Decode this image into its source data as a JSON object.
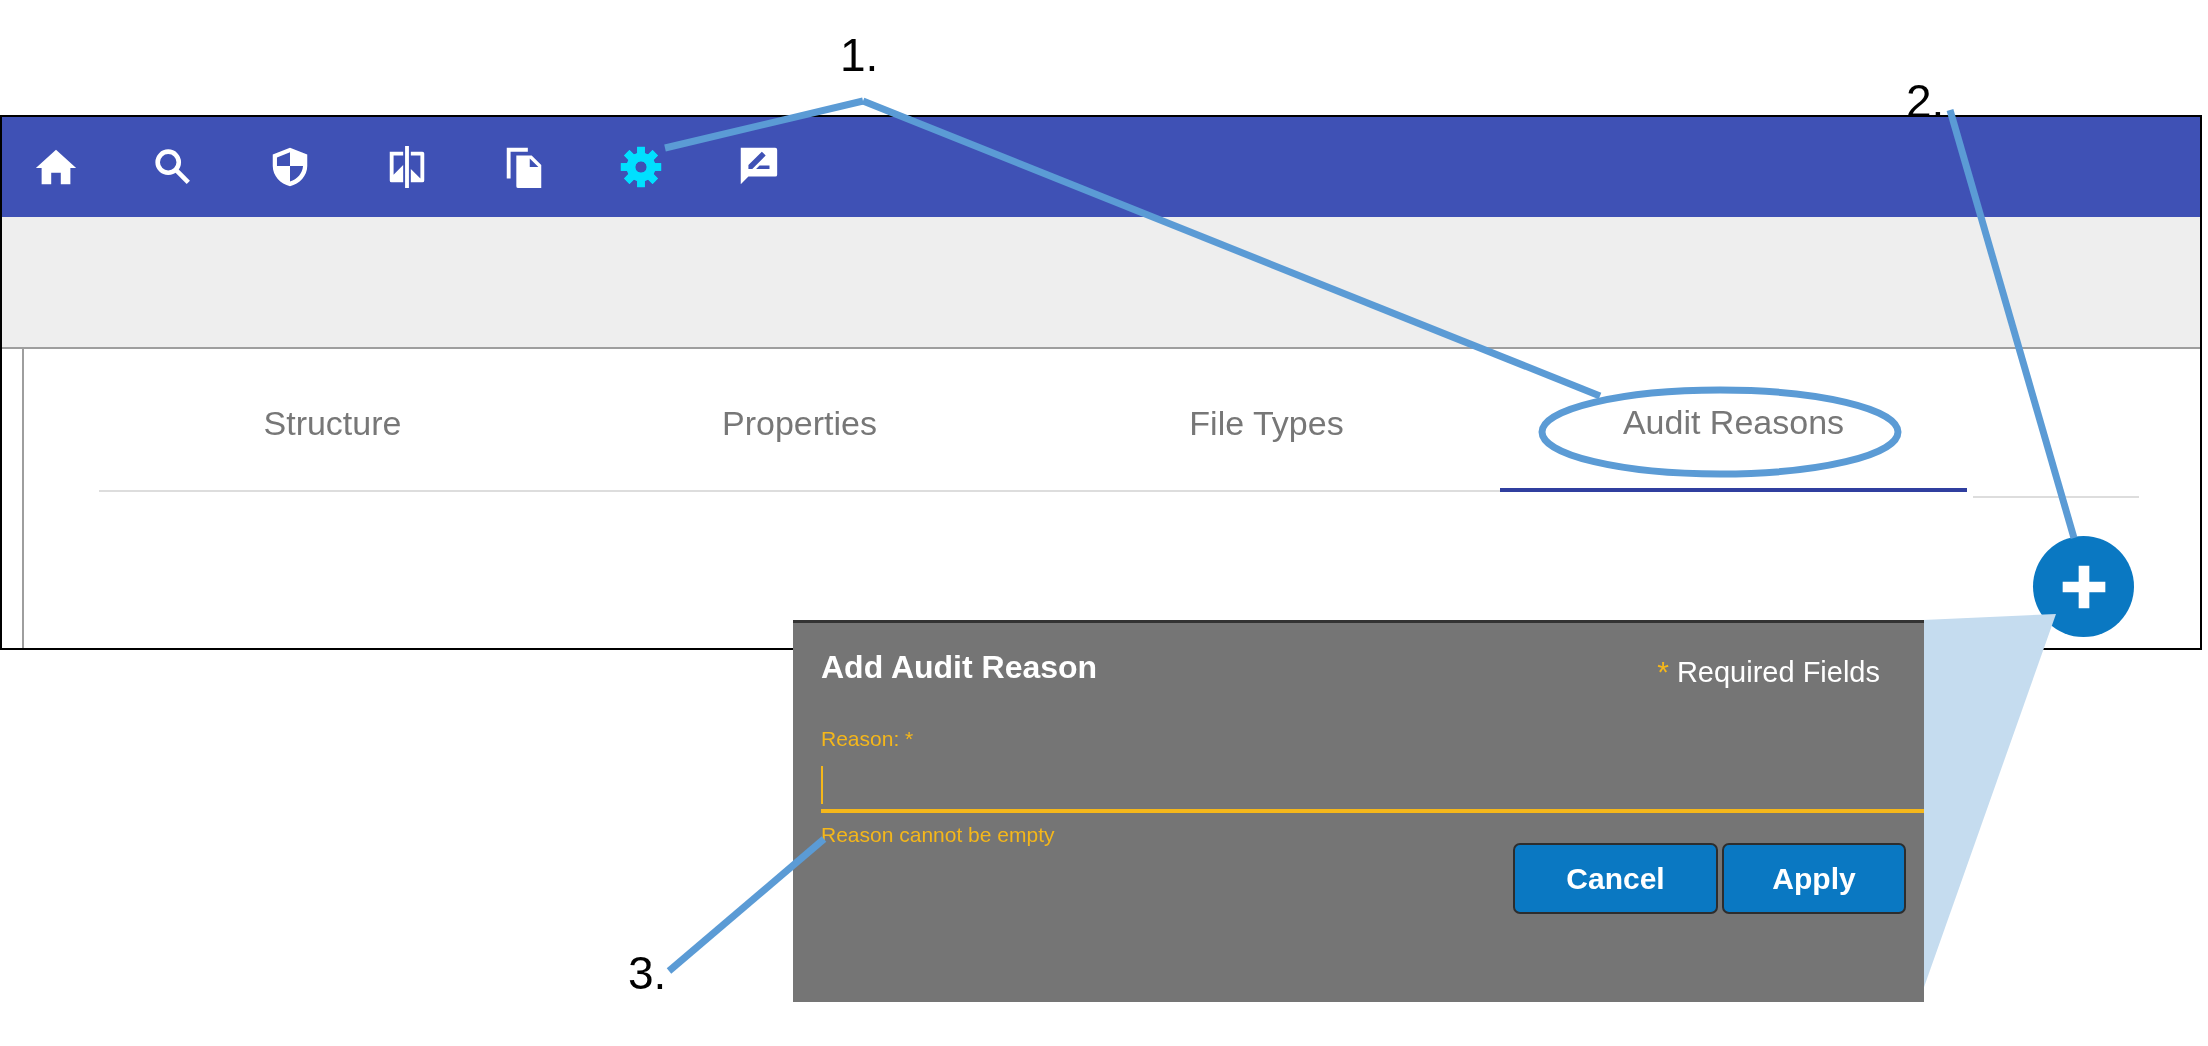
{
  "toolbar": [
    {
      "kind": "home",
      "selected": false
    },
    {
      "kind": "search",
      "selected": false
    },
    {
      "kind": "shield",
      "selected": false
    },
    {
      "kind": "compare",
      "selected": false
    },
    {
      "kind": "copy",
      "selected": false
    },
    {
      "kind": "settings",
      "selected": true
    },
    {
      "kind": "feedback",
      "selected": false
    }
  ],
  "tabs": [
    {
      "label": "Structure",
      "selected": false
    },
    {
      "label": "Properties",
      "selected": false
    },
    {
      "label": "File Types",
      "selected": false
    },
    {
      "label": "Audit Reasons",
      "selected": true
    }
  ],
  "dialog": {
    "title": "Add Audit Reason",
    "required_mark": "*",
    "required_note": "Required Fields",
    "field": {
      "label": "Reason: *",
      "focused": true,
      "error": "Reason cannot be empty"
    },
    "buttons": [
      "Cancel",
      "Apply"
    ]
  },
  "annotations": [
    {
      "label": "1."
    },
    {
      "label": "2."
    },
    {
      "label": "3."
    }
  ]
}
